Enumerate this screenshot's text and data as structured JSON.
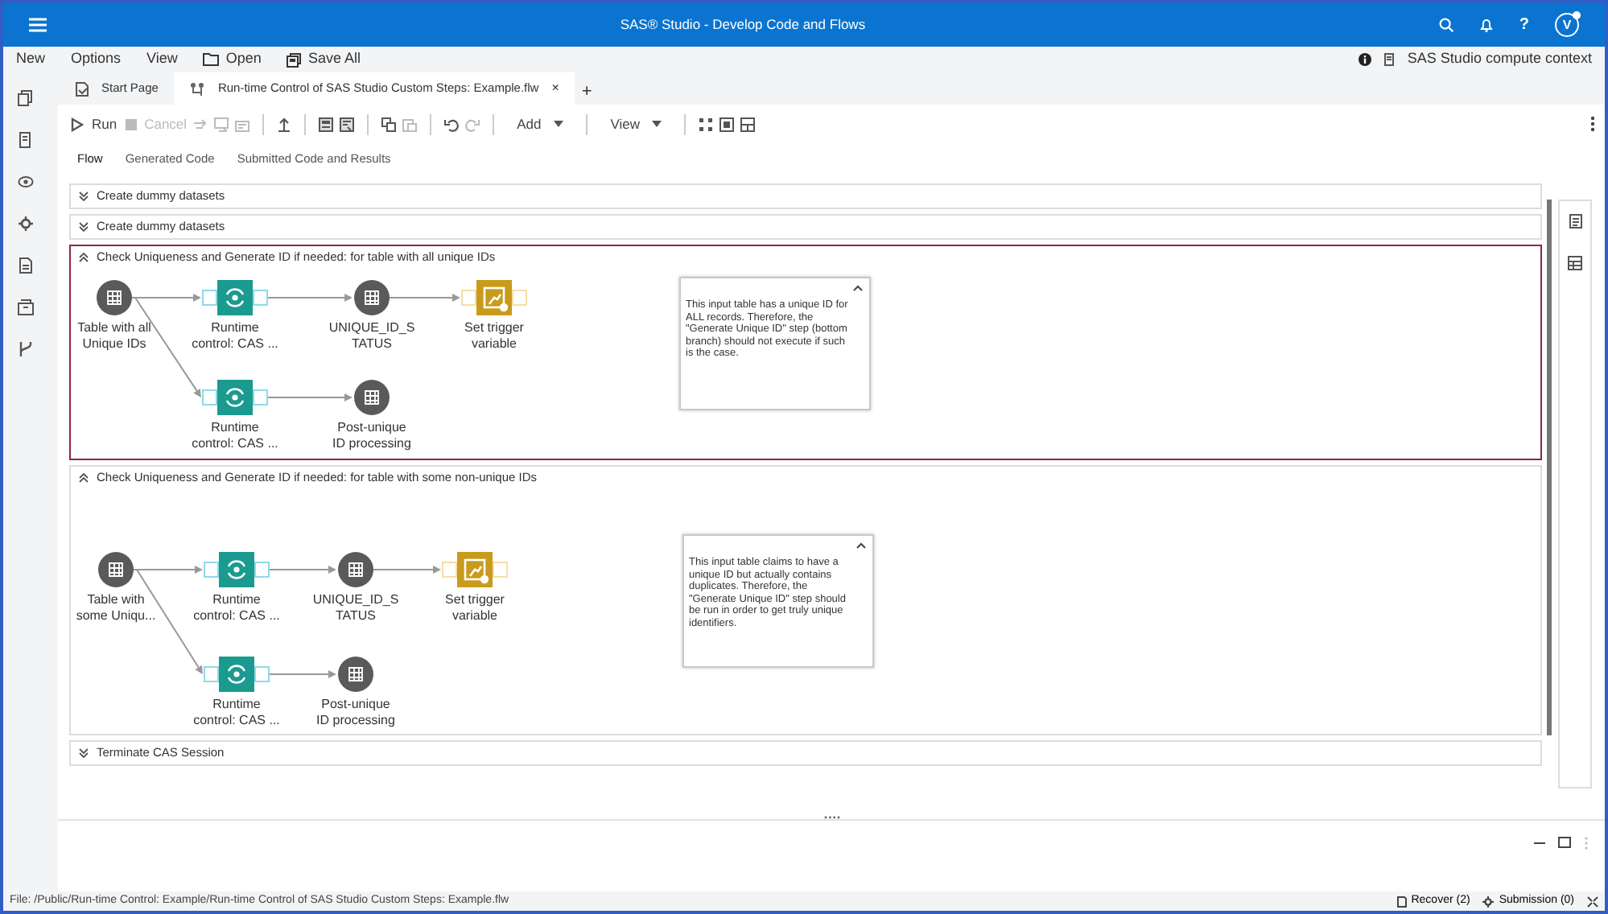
{
  "app_bar": {
    "title": "SAS® Studio - Develop Code and Flows",
    "help": "?",
    "avatar": "V"
  },
  "menu": [
    {
      "kind": "text",
      "label": "New"
    },
    {
      "kind": "text",
      "label": "Options"
    },
    {
      "kind": "text",
      "label": "View"
    },
    {
      "kind": "folder",
      "label": "Open"
    },
    {
      "kind": "save",
      "label": "Save All"
    }
  ],
  "context": "SAS Studio compute context",
  "tabs": [
    {
      "kind": "page",
      "label": "Start Page",
      "selected": false
    },
    {
      "kind": "flow",
      "label": "Run-time Control of SAS Studio Custom Steps: Example.flw",
      "selected": true,
      "close": "×"
    }
  ],
  "add_tab": "+",
  "toolbar": [
    [
      {
        "kind": "run",
        "label": "Run",
        "disabled": false
      },
      {
        "kind": "stop",
        "label": "Cancel",
        "disabled": true
      },
      {
        "kind": "step",
        "disabled": true
      },
      {
        "kind": "step-into",
        "disabled": true
      },
      {
        "kind": "step-out",
        "disabled": true
      }
    ],
    [
      {
        "kind": "upload",
        "disabled": false
      }
    ],
    [
      {
        "kind": "node-in",
        "disabled": false
      },
      {
        "kind": "node-out",
        "disabled": false
      }
    ],
    [
      {
        "kind": "copy",
        "disabled": false
      },
      {
        "kind": "paste",
        "disabled": true
      }
    ],
    [
      {
        "kind": "undo",
        "disabled": false
      },
      {
        "kind": "redo",
        "disabled": true
      }
    ],
    [
      {
        "kind": "dropdown",
        "label": "Add",
        "disabled": false
      }
    ],
    [
      {
        "kind": "dropdown",
        "label": "View",
        "disabled": false
      }
    ],
    [
      {
        "kind": "layout",
        "disabled": false
      },
      {
        "kind": "frame",
        "disabled": false
      },
      {
        "kind": "panels",
        "disabled": false
      }
    ]
  ],
  "subtabs": [
    {
      "label": "Flow",
      "selected": true
    },
    {
      "label": "Generated Code",
      "selected": false
    },
    {
      "label": "Submitted Code and Results",
      "selected": false
    }
  ],
  "sections": [
    {
      "title": "Create dummy datasets",
      "expanded": false,
      "highlighted": false
    },
    {
      "title": "Create dummy datasets",
      "expanded": false,
      "highlighted": false
    },
    {
      "title": "Check Uniqueness and Generate ID if needed: for table with all unique IDs",
      "expanded": true,
      "highlighted": true,
      "nodes": [
        {
          "kind": "table",
          "label": [
            "Table with all",
            "Unique IDs"
          ]
        },
        {
          "kind": "runtime",
          "label": [
            "Runtime",
            "control: CAS ..."
          ]
        },
        {
          "kind": "table",
          "label": [
            "UNIQUE_ID_S",
            "TATUS"
          ]
        },
        {
          "kind": "trigger",
          "label": [
            "Set trigger",
            "variable"
          ]
        },
        {
          "kind": "runtime",
          "label": [
            "Runtime",
            "control: CAS ..."
          ]
        },
        {
          "kind": "table",
          "label": [
            "Post-unique",
            "ID processing"
          ]
        }
      ],
      "note": "This input table has a unique ID for ALL records.  Therefore, the \"Generate Unique ID\" step (bottom branch) should not execute if such is the case."
    },
    {
      "title": "Check Uniqueness and Generate ID if needed: for table with some non-unique IDs",
      "expanded": true,
      "highlighted": false,
      "nodes": [
        {
          "kind": "table",
          "label": [
            "Table with",
            "some Uniqu..."
          ]
        },
        {
          "kind": "runtime",
          "label": [
            "Runtime",
            "control: CAS ..."
          ]
        },
        {
          "kind": "table",
          "label": [
            "UNIQUE_ID_S",
            "TATUS"
          ]
        },
        {
          "kind": "trigger",
          "label": [
            "Set trigger",
            "variable"
          ]
        },
        {
          "kind": "runtime",
          "label": [
            "Runtime",
            "control: CAS ..."
          ]
        },
        {
          "kind": "table",
          "label": [
            "Post-unique",
            "ID processing"
          ]
        }
      ],
      "note": "This input table claims to have a unique ID but actually contains duplicates. Therefore, the \"Generate Unique ID\" step should be run in order to get truly unique identifiers."
    },
    {
      "title": "Terminate CAS Session",
      "expanded": false,
      "highlighted": false
    }
  ],
  "status_bar": {
    "file": "File: /Public/Run-time Control: Example/Run-time Control of SAS Studio Custom Steps: Example.flw",
    "recover": "Recover (2)",
    "submission": "Submission (0)"
  }
}
